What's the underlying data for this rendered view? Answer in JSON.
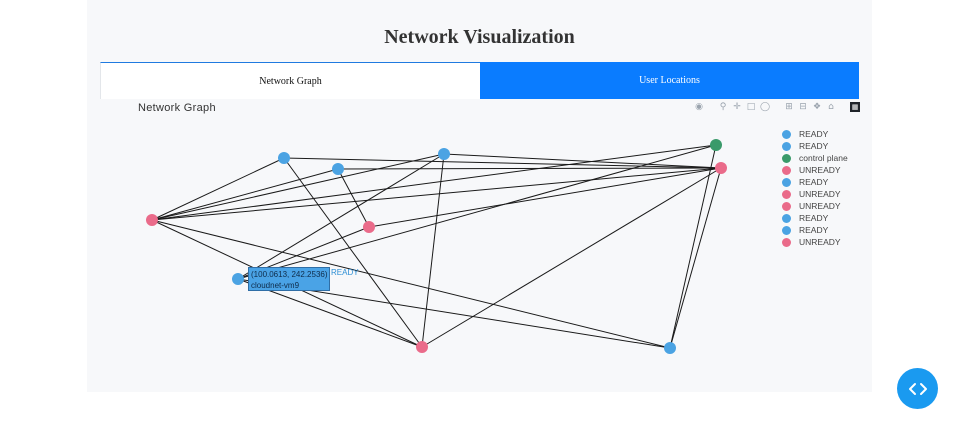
{
  "page": {
    "title": "Network Visualization"
  },
  "tabs": [
    {
      "label": "Network Graph",
      "active": true
    },
    {
      "label": "User Locations",
      "active": false
    }
  ],
  "graph": {
    "title": "Network Graph",
    "modebar": [
      "camera-icon",
      "zoom-icon",
      "pan-icon",
      "box-select-icon",
      "lasso-icon",
      "zoom-in-icon",
      "zoom-out-icon",
      "autoscale-icon",
      "home-icon",
      "plotly-logo-icon"
    ],
    "colors": {
      "ready": "#4ba3e3",
      "unready": "#ea6b8a",
      "control_plane": "#3a9a6a",
      "edge": "#1a1a1a"
    },
    "legend": [
      {
        "label": "READY",
        "status": "ready"
      },
      {
        "label": "READY",
        "status": "ready"
      },
      {
        "label": "control plane",
        "status": "control_plane"
      },
      {
        "label": "UNREADY",
        "status": "unready"
      },
      {
        "label": "READY",
        "status": "ready"
      },
      {
        "label": "UNREADY",
        "status": "unready"
      },
      {
        "label": "UNREADY",
        "status": "unready"
      },
      {
        "label": "READY",
        "status": "ready"
      },
      {
        "label": "READY",
        "status": "ready"
      },
      {
        "label": "UNREADY",
        "status": "unready"
      }
    ],
    "tooltip": {
      "line1": "(100.0613, 242.2536)",
      "line2": "cloudnet-vm9",
      "extra": "READY"
    }
  },
  "fab": {
    "icon": "code-icon"
  }
}
